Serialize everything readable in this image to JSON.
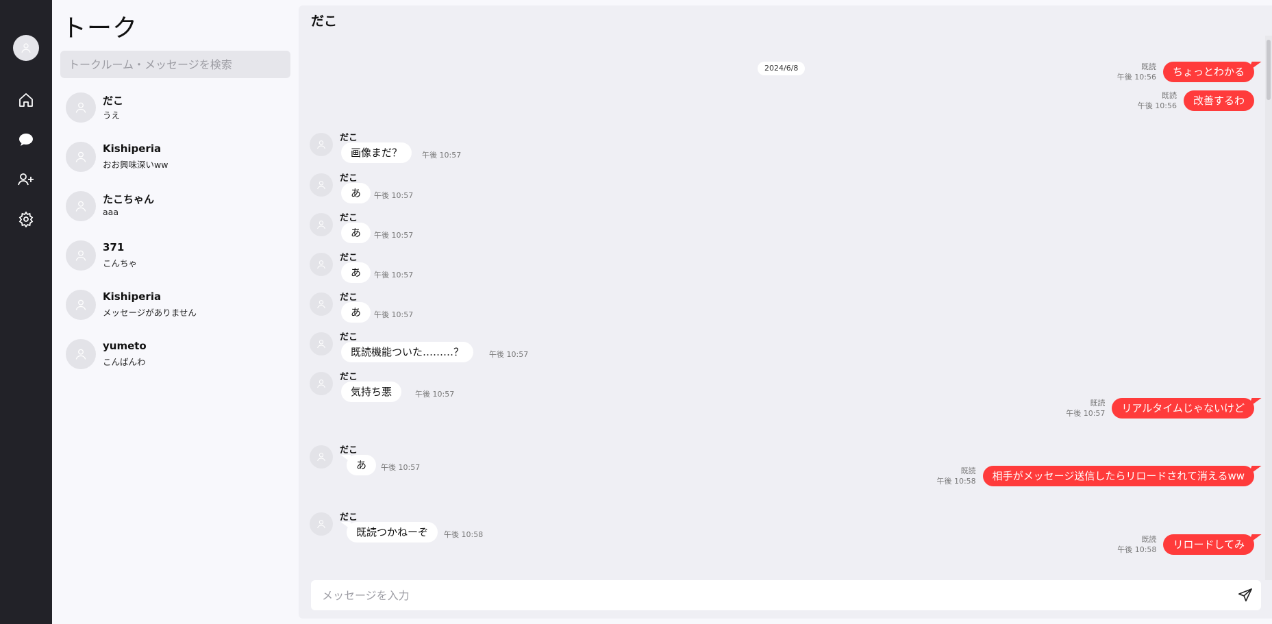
{
  "nav": {
    "items": [
      {
        "icon": "user-icon",
        "label": ""
      },
      {
        "icon": "home-icon",
        "label": ""
      },
      {
        "icon": "chat-bubble-icon",
        "label": ""
      },
      {
        "icon": "add-friend-icon",
        "label": ""
      },
      {
        "icon": "gear-icon",
        "label": ""
      }
    ]
  },
  "talk_list": {
    "title": "トーク",
    "search_placeholder": "トークルーム・メッセージを検索",
    "rooms": [
      {
        "name": "だこ",
        "last": "うえ"
      },
      {
        "name": "Kishiperia",
        "last": "おお興味深いww"
      },
      {
        "name": "たこちゃん",
        "last": "aaa"
      },
      {
        "name": "371",
        "last": "こんちゃ"
      },
      {
        "name": "Kishiperia",
        "last": "メッセージがありません"
      },
      {
        "name": "yumeto",
        "last": "こんばんわ"
      }
    ]
  },
  "chat": {
    "title": "だこ",
    "date": "2024/6/8",
    "messages": [
      {
        "dir": "out",
        "read": "既読",
        "time": "午後 10:56",
        "text": "ちょっとわかる"
      },
      {
        "dir": "out",
        "read": "既読",
        "time": "午後 10:56",
        "text": "改善するわ"
      },
      {
        "dir": "in",
        "sender": "だこ",
        "time": "午後 10:57",
        "text": "画像まだ？"
      },
      {
        "dir": "in",
        "sender": "だこ",
        "time": "午後 10:57",
        "text": "あ"
      },
      {
        "dir": "in",
        "sender": "だこ",
        "time": "午後 10:57",
        "text": "あ"
      },
      {
        "dir": "in",
        "sender": "だこ",
        "time": "午後 10:57",
        "text": "あ"
      },
      {
        "dir": "in",
        "sender": "だこ",
        "time": "午後 10:57",
        "text": "あ"
      },
      {
        "dir": "in",
        "sender": "だこ",
        "time": "午後 10:57",
        "text": "既読機能ついた………？"
      },
      {
        "dir": "in",
        "sender": "だこ",
        "time": "午後 10:57",
        "text": "気持ち悪"
      },
      {
        "dir": "out",
        "read": "既読",
        "time": "午後 10:57",
        "text": "リアルタイムじゃないけど"
      },
      {
        "dir": "in",
        "sender": "だこ",
        "time": "午後 10:57",
        "text": "あ"
      },
      {
        "dir": "out",
        "read": "既読",
        "time": "午後 10:58",
        "text": "相手がメッセージ送信したらリロードされて消えるww"
      },
      {
        "dir": "in",
        "sender": "だこ",
        "time": "午後 10:58",
        "text": "既読つかねーぞ"
      },
      {
        "dir": "out",
        "read": "既読",
        "time": "午後 10:58",
        "text": "リロードしてみ"
      }
    ],
    "composer_placeholder": "メッセージを入力"
  },
  "colors": {
    "rail_bg": "#222228",
    "accent_red": "#ff3b3b",
    "chat_bg": "#efeff4"
  }
}
